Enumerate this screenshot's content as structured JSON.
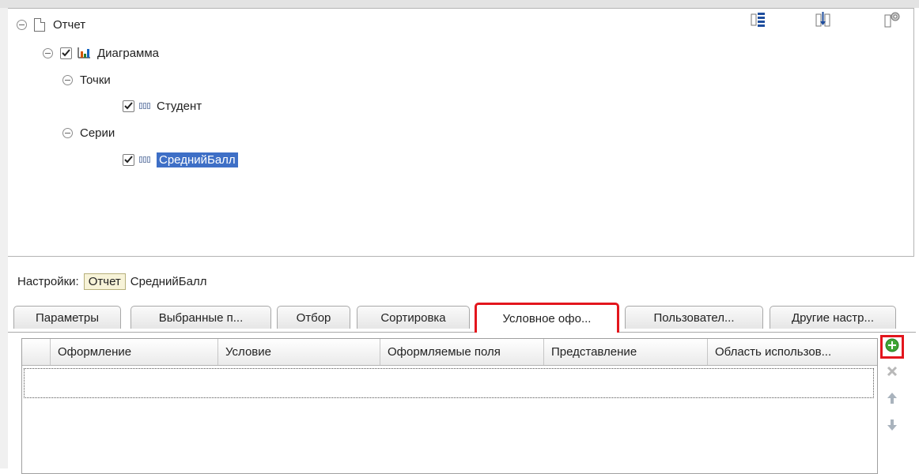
{
  "tree": {
    "root_label": "Отчет",
    "chart_label": "Диаграмма",
    "points_label": "Точки",
    "points_item": "Студент",
    "series_label": "Серии",
    "series_item": "СреднийБалл"
  },
  "toolbar_icons": [
    "group-add-icon",
    "field-insert-icon",
    "settings-icon"
  ],
  "settings": {
    "label": "Настройки:",
    "crumb_report": "Отчет",
    "crumb_item": "СреднийБалл"
  },
  "tabs": [
    {
      "label": "Параметры"
    },
    {
      "label": "Выбранные п..."
    },
    {
      "label": "Отбор"
    },
    {
      "label": "Сортировка"
    },
    {
      "label": "Условное офо..."
    },
    {
      "label": "Пользовател..."
    },
    {
      "label": "Другие настр..."
    }
  ],
  "active_tab": "Условное офо...",
  "grid": {
    "columns": [
      "Оформление",
      "Условие",
      "Оформляемые поля",
      "Представление",
      "Область использов..."
    ]
  },
  "side_buttons": [
    "add-icon",
    "delete-icon",
    "move-up-icon",
    "move-down-icon"
  ],
  "colors": {
    "highlight": "#e3161d",
    "selection": "#3e6fc6",
    "add_green": "#3fa535"
  }
}
